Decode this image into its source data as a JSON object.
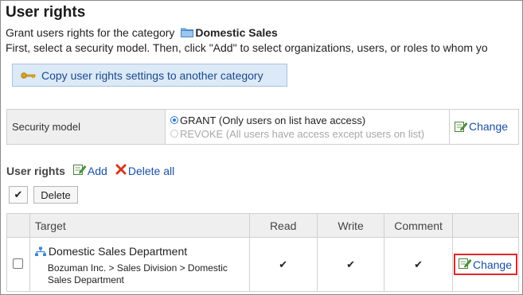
{
  "page": {
    "title": "User rights",
    "intro_prefix": "Grant users rights for the category",
    "category_name": "Domestic Sales",
    "instruction": "First, select a security model. Then, click \"Add\" to select organizations, users, or roles to whom yo"
  },
  "copy_button": {
    "label": "Copy user rights settings to another category",
    "icon": "key-icon"
  },
  "security": {
    "label": "Security model",
    "options": [
      {
        "label": "GRANT (Only users on list have access)",
        "selected": true,
        "enabled": true
      },
      {
        "label": "REVOKE (All users have access except users on list)",
        "selected": false,
        "enabled": false
      }
    ],
    "change_label": "Change"
  },
  "rights": {
    "label": "User rights",
    "add_label": "Add",
    "delete_all_label": "Delete all",
    "select_all_glyph": "✔",
    "delete_label": "Delete"
  },
  "table": {
    "columns": [
      "Target",
      "Read",
      "Write",
      "Comment"
    ],
    "rows": [
      {
        "name": "Domestic Sales Department",
        "path_line1": "Bozuman Inc. > Sales Division > Domestic",
        "path_line2": "Sales Department",
        "read": "✔",
        "write": "✔",
        "comment": "✔",
        "change_label": "Change"
      }
    ]
  },
  "colors": {
    "link": "#1a4fa3",
    "highlight": "#e3262a",
    "button_bg": "#dce9f7"
  }
}
